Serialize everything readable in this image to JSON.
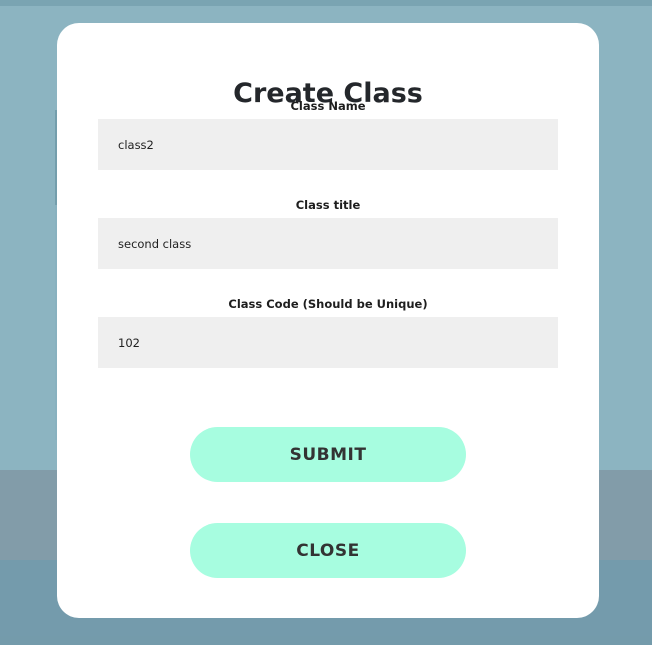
{
  "modal": {
    "title": "Create Class",
    "fields": [
      {
        "label": "Class Name",
        "value": "class2"
      },
      {
        "label": "Class title",
        "value": "second class"
      },
      {
        "label": "Class Code (Should be Unique)",
        "value": "102"
      }
    ],
    "submit_label": "SUBMIT",
    "close_label": "CLOSE"
  },
  "colors": {
    "overlay": "#7caab8",
    "modal_background": "#ffffff",
    "input_background": "#efefef",
    "button_background": "#a7fde0",
    "button_text": "#333333",
    "background_red": "#a93a3a",
    "background_dark": "#3a3150"
  }
}
